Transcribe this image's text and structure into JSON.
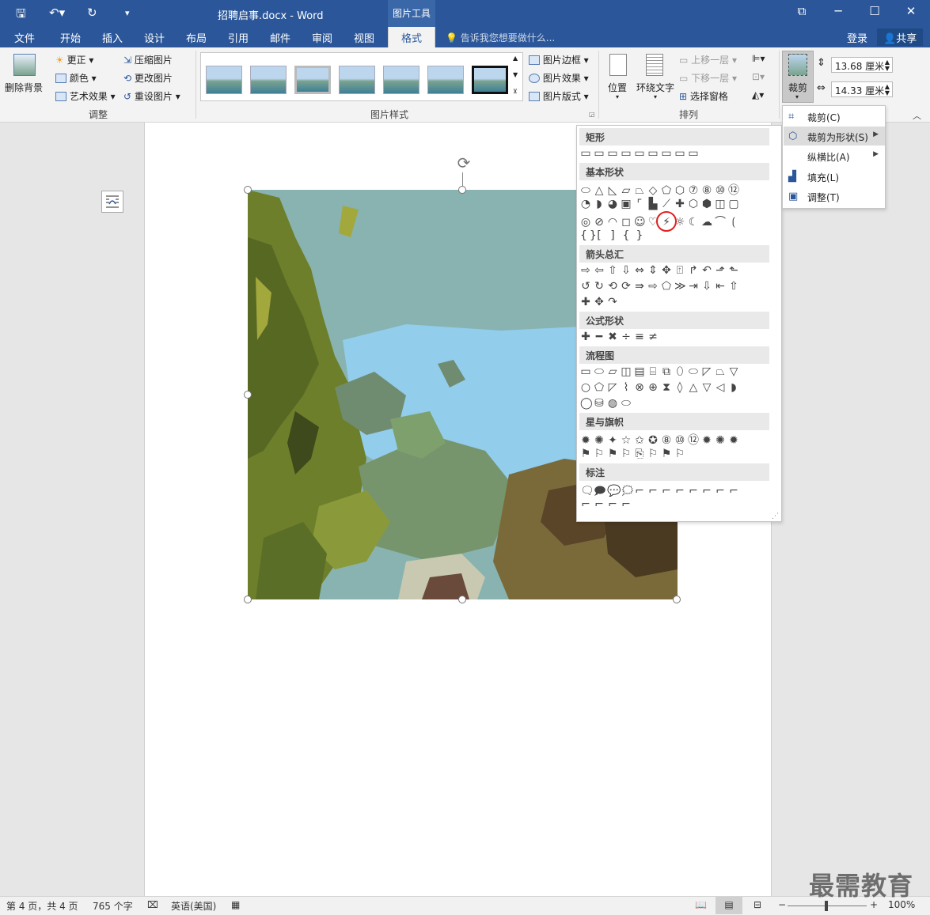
{
  "titlebar": {
    "doc_title": "招聘启事.docx - Word",
    "context_tool": "图片工具",
    "icons": [
      "save-icon",
      "undo-icon",
      "redo-icon",
      "customize-icon"
    ],
    "win_icons": [
      "ribbon-display-icon",
      "minimize-icon",
      "maximize-icon",
      "close-icon"
    ]
  },
  "tabs": [
    "文件",
    "开始",
    "插入",
    "设计",
    "布局",
    "引用",
    "邮件",
    "审阅",
    "视图",
    "格式"
  ],
  "active_tab": "格式",
  "tellme": "告诉我您想要做什么...",
  "login": "登录",
  "share": "共享",
  "ribbon": {
    "remove_bg": "删除背景",
    "corrections": "更正",
    "color": "颜色",
    "artistic": "艺术效果",
    "compress": "压缩图片",
    "change": "更改图片",
    "reset": "重设图片",
    "group_adjust": "调整",
    "border": "图片边框",
    "effects": "图片效果",
    "layout": "图片版式",
    "group_styles": "图片样式",
    "position": "位置",
    "wrap": "环绕文字",
    "bring_forward": "上移一层",
    "send_backward": "下移一层",
    "selection_pane": "选择窗格",
    "group_arrange": "排列",
    "crop": "裁剪",
    "height": "13.68 厘米",
    "width": "14.33 厘米"
  },
  "crop_menu": [
    {
      "label": "裁剪(C)",
      "icon": "crop-icon"
    },
    {
      "label": "裁剪为形状(S)",
      "icon": "crop-shape-icon"
    },
    {
      "label": "纵横比(A)",
      "icon": ""
    },
    {
      "label": "填充(L)",
      "icon": "fill-icon"
    },
    {
      "label": "调整(T)",
      "icon": "fit-icon"
    }
  ],
  "shape_categories": [
    "矩形",
    "基本形状",
    "箭头总汇",
    "公式形状",
    "流程图",
    "星与旗帜",
    "标注"
  ],
  "status": {
    "page": "第 4 页，共 4 页",
    "words": "765 个字",
    "language": "英语(美国)",
    "zoom": "100%"
  },
  "watermark": "最需教育",
  "colors": {
    "accent": "#2b579a",
    "highlight_circle": "#e02020",
    "sky": "#8fd0f0",
    "foliage": "#6d7f2a"
  }
}
